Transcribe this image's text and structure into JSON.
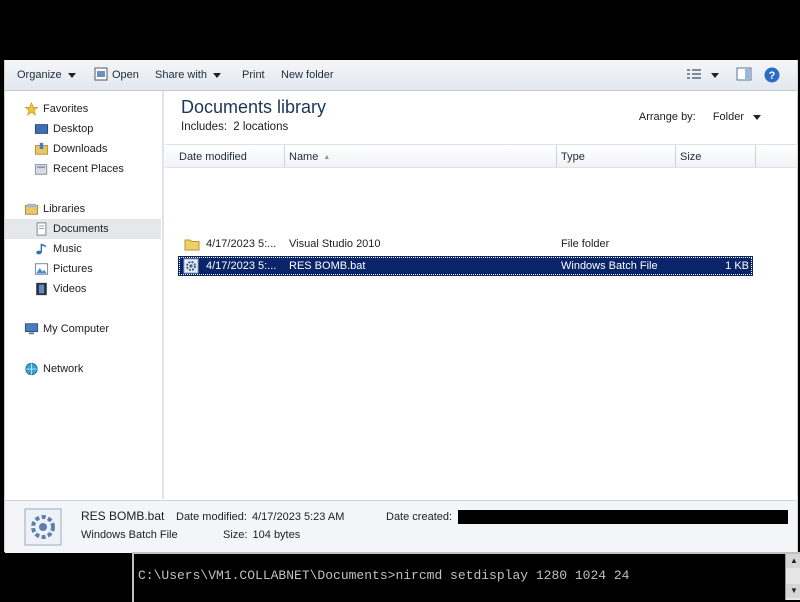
{
  "toolbar": {
    "organize": "Organize",
    "open": "Open",
    "share_with": "Share with",
    "print": "Print",
    "new_folder": "New folder"
  },
  "nav": {
    "favorites": "Favorites",
    "desktop": "Desktop",
    "downloads": "Downloads",
    "recent_places": "Recent Places",
    "libraries": "Libraries",
    "documents": "Documents",
    "music": "Music",
    "pictures": "Pictures",
    "videos": "Videos",
    "my_computer": "My Computer",
    "network": "Network"
  },
  "library": {
    "title": "Documents library",
    "includes_label": "Includes:",
    "includes_value": "2 locations",
    "arrange_label": "Arrange by:",
    "arrange_value": "Folder"
  },
  "columns": {
    "date": "Date modified",
    "name": "Name",
    "type": "Type",
    "size": "Size"
  },
  "files": [
    {
      "date": "4/17/2023 5:...",
      "name": "Visual Studio 2010",
      "type": "File folder",
      "size": ""
    },
    {
      "date": "4/17/2023 5:...",
      "name": "RES BOMB.bat",
      "type": "Windows Batch File",
      "size": "1 KB"
    }
  ],
  "details": {
    "name": "RES BOMB.bat",
    "type": "Windows Batch File",
    "date_modified_label": "Date modified:",
    "date_modified_value": "4/17/2023 5:23 AM",
    "size_label": "Size:",
    "size_value": "104 bytes",
    "date_created_label": "Date created:"
  },
  "console": {
    "command": "C:\\Users\\VM1.COLLABNET\\Documents>nircmd setdisplay 1280 1024 24"
  },
  "colors": {
    "selection": "#0a246a",
    "title": "#1e3559"
  }
}
